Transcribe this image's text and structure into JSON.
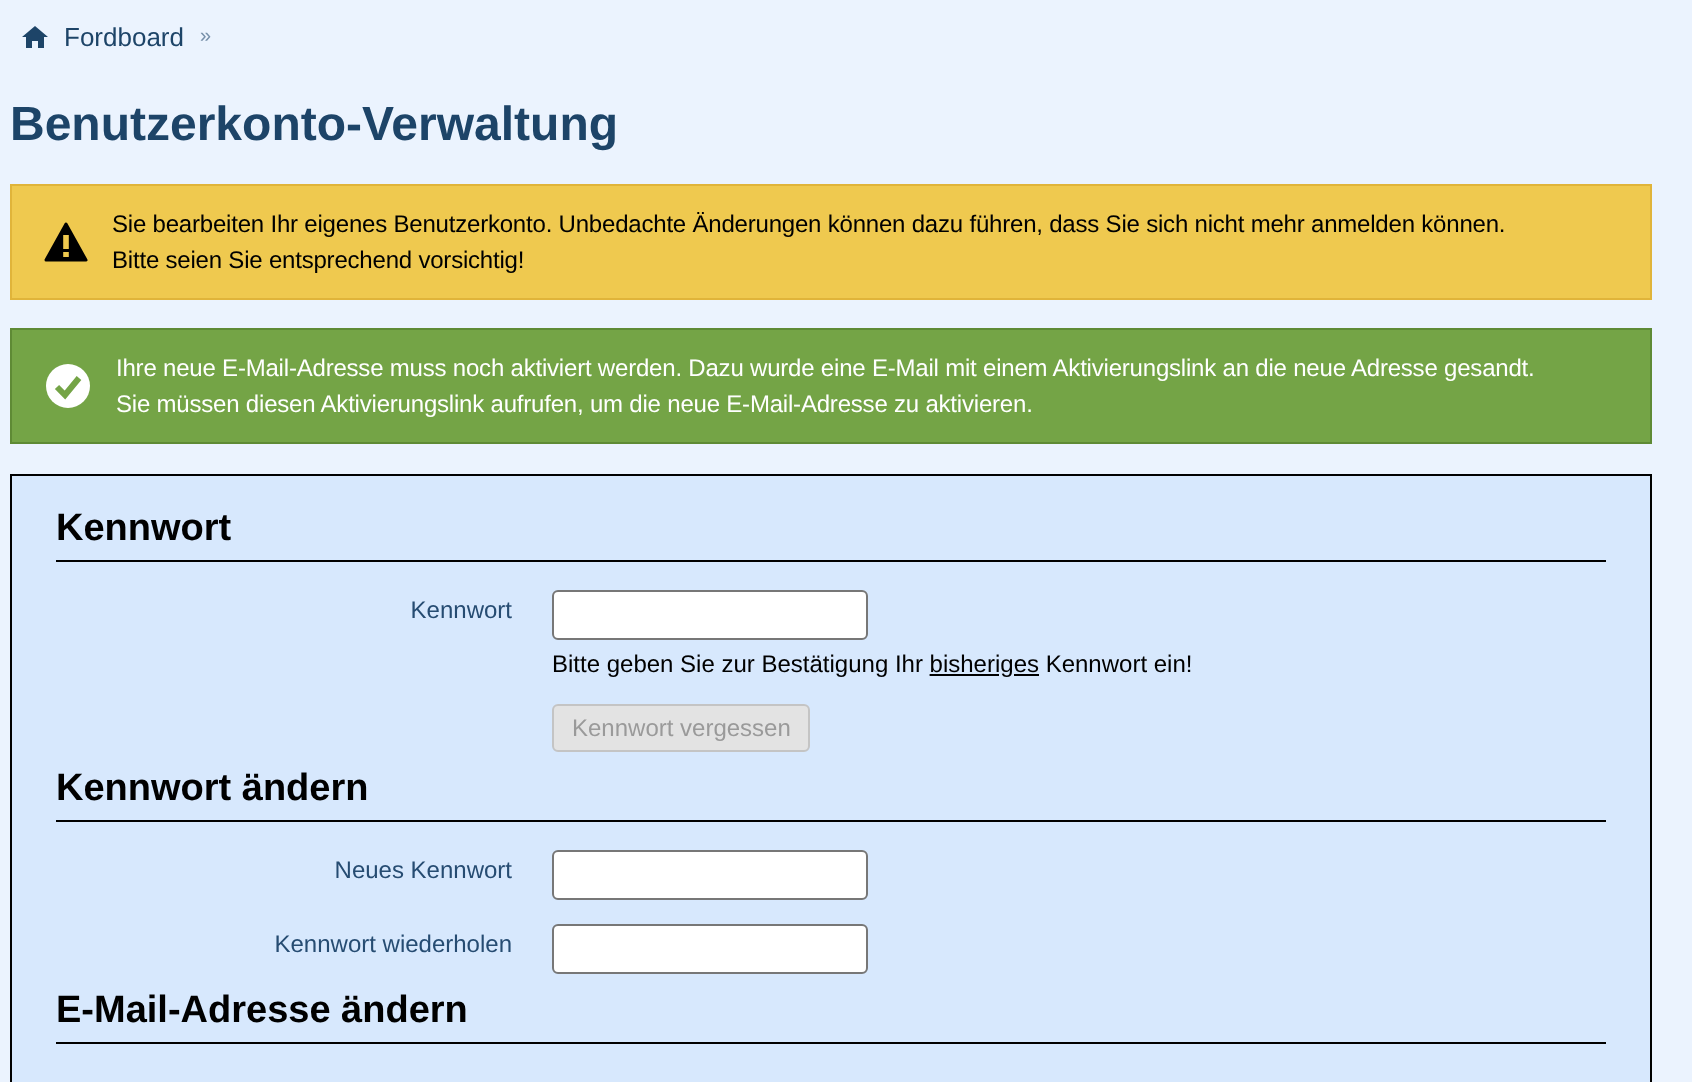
{
  "breadcrumb": {
    "items": [
      {
        "label": "Fordboard"
      }
    ],
    "separator": "»"
  },
  "title": "Benutzerkonto-Verwaltung",
  "notices": [
    {
      "kind": "warning",
      "lines": [
        "Sie bearbeiten Ihr eigenes Benutzerkonto. Unbedachte Änderungen können dazu führen, dass Sie sich nicht mehr anmelden können.",
        "Bitte seien Sie entsprechend vorsichtig!"
      ]
    },
    {
      "kind": "success",
      "lines": [
        "Ihre neue E-Mail-Adresse muss noch aktiviert werden. Dazu wurde eine E-Mail mit einem Aktivierungslink an die neue Adresse gesandt.",
        "Sie müssen diesen Aktivierungslink aufrufen, um die neue E-Mail-Adresse zu aktivieren."
      ]
    }
  ],
  "sections": [
    {
      "title": "Kennwort",
      "fields": [
        {
          "label": "Kennwort",
          "description": [
            {
              "text": "Bitte geben Sie zur Bestätigung Ihr ",
              "underlined": false
            },
            {
              "text": "bisheriges",
              "underlined": true
            },
            {
              "text": " Kennwort ein!",
              "underlined": false
            }
          ],
          "button": {
            "label": "Kennwort vergessen",
            "disabled": true
          }
        }
      ]
    },
    {
      "title": "Kennwort ändern",
      "fields": [
        {
          "label": "Neues Kennwort"
        },
        {
          "label": "Kennwort wiederholen"
        }
      ]
    },
    {
      "title": "E-Mail-Adresse ändern"
    }
  ]
}
